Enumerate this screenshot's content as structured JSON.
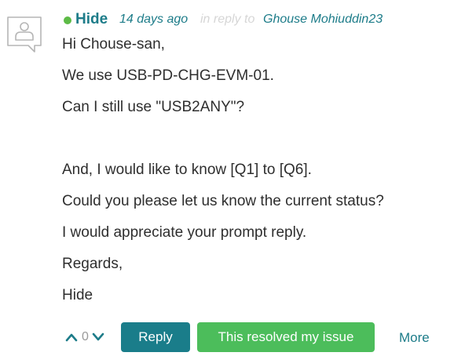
{
  "post": {
    "author": "Hide",
    "time": "14 days ago",
    "in_reply_to_label": "in reply to",
    "reply_target": "Ghouse Mohiuddin23",
    "body_lines": [
      "Hi Chouse-san,",
      "We use USB-PD-CHG-EVM-01.",
      "Can I still use \"USB2ANY\"?",
      "And, I would like to know [Q1] to [Q6].",
      "Could you please let us know the current status?",
      "I would appreciate your prompt reply.",
      "Regards,",
      "Hide"
    ]
  },
  "actions": {
    "vote_count": "0",
    "reply_label": "Reply",
    "resolved_label": "This resolved my issue",
    "more_label": "More"
  },
  "colors": {
    "accent": "#1d7c89",
    "reply_button": "#1a7d8a",
    "resolved_button": "#4cbd5b",
    "online": "#5dbb46",
    "muted": "#d6d6d6"
  },
  "icons": {
    "avatar": "user-chat-bubble-icon",
    "online": "online-status-dot",
    "vote_up": "chevron-up-icon",
    "vote_down": "chevron-down-icon"
  }
}
